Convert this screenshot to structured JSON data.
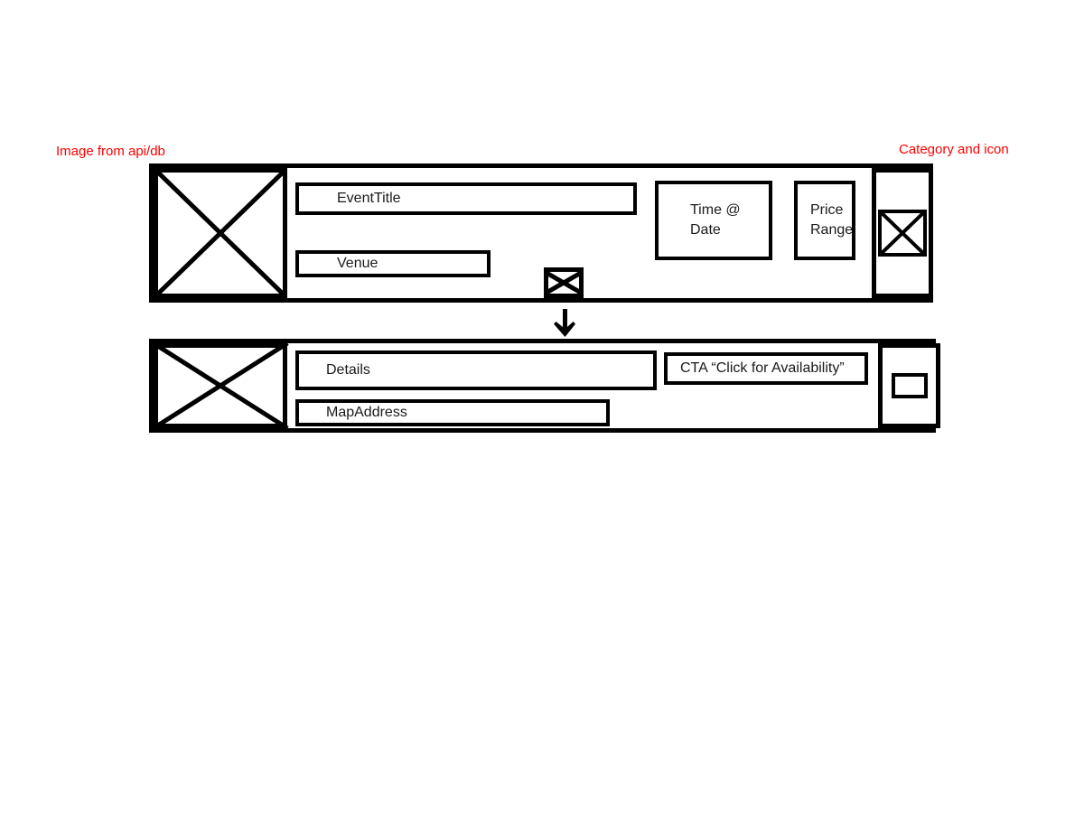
{
  "annotations": {
    "image_source": "Image from api/db",
    "category": "Category and icon"
  },
  "event_card": {
    "thumbnail_name": "image-placeholder",
    "title_field": "EventTitle",
    "venue_field": "Venue",
    "time_field": {
      "line1": "Time @",
      "line2": "Date"
    },
    "price_field": {
      "line1": "Price",
      "line2": "Range"
    },
    "category_icon": "category-x-icon",
    "attachment_icon": "envelope-icon"
  },
  "flow": {
    "arrow": "down-arrow"
  },
  "details_card": {
    "thumbnail_name": "image-placeholder",
    "details_field": "Details",
    "map_field": "MapAddress",
    "cta_field": "CTA “Click for Availability”",
    "secondary_icon": "rectangle-icon"
  },
  "colors": {
    "annotation": "#ff0000",
    "stroke": "#000000",
    "background": "#ffffff"
  }
}
